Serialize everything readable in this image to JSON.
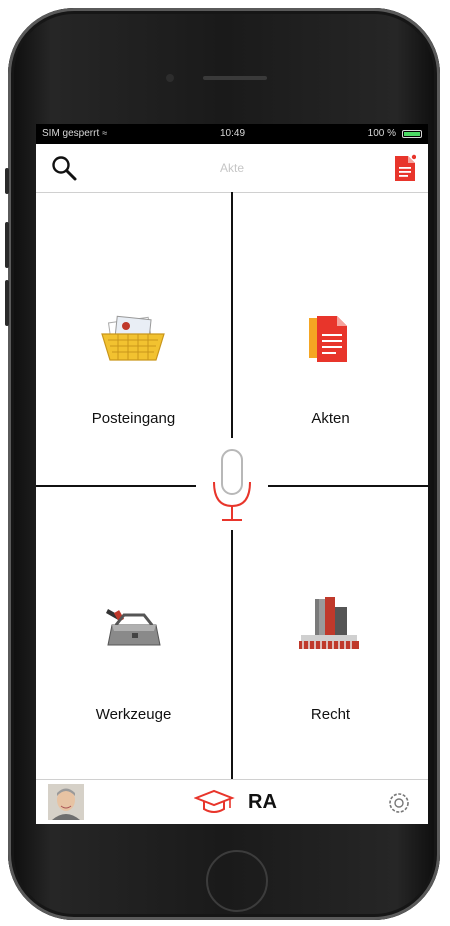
{
  "statusbar": {
    "carrier": "SIM gesperrt",
    "time": "10:49",
    "battery": "100 %"
  },
  "navbar": {
    "title": "Akte"
  },
  "tiles": [
    {
      "label": "Posteingang",
      "icon": "inbox-tray-icon"
    },
    {
      "label": "Akten",
      "icon": "documents-icon"
    },
    {
      "label": "Werkzeuge",
      "icon": "toolbox-icon"
    },
    {
      "label": "Recht",
      "icon": "law-building-icon"
    }
  ],
  "center": {
    "icon": "microphone-icon"
  },
  "tabbar": {
    "brand": "RA",
    "icons": [
      "avatar",
      "graduation-cap-logo-icon",
      "settings-icon"
    ]
  },
  "colors": {
    "accent": "#e8352b",
    "divider": "#111111",
    "title_gray": "#c6c6c6",
    "yellow": "#f2c230"
  }
}
